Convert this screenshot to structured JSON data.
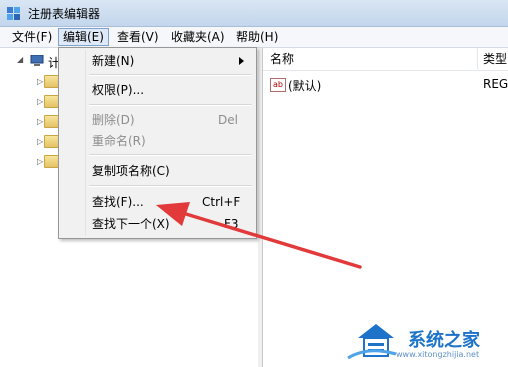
{
  "window": {
    "title": "注册表编辑器"
  },
  "menubar": {
    "items": [
      {
        "label": "文件(F)"
      },
      {
        "label": "编辑(E)"
      },
      {
        "label": "查看(V)"
      },
      {
        "label": "收藏夹(A)"
      },
      {
        "label": "帮助(H)"
      }
    ]
  },
  "tree": {
    "root_label": "计"
  },
  "edit_menu": {
    "new": {
      "label": "新建(N)"
    },
    "permissions": {
      "label": "权限(P)..."
    },
    "delete": {
      "label": "删除(D)",
      "shortcut": "Del"
    },
    "rename": {
      "label": "重命名(R)"
    },
    "copy_key_name": {
      "label": "复制项名称(C)"
    },
    "find": {
      "label": "查找(F)...",
      "shortcut": "Ctrl+F"
    },
    "find_next": {
      "label": "查找下一个(X)",
      "shortcut": "F3"
    }
  },
  "list": {
    "columns": {
      "name": "名称",
      "type": "类型"
    },
    "rows": [
      {
        "icon": "ab",
        "name": "(默认)",
        "type": "REG"
      }
    ]
  },
  "watermark": {
    "brand": "系统之家",
    "url": "www.xitongzhijia.net"
  },
  "colors": {
    "arrow": "#e23a3a",
    "watermark_blue": "#1c73c8"
  }
}
